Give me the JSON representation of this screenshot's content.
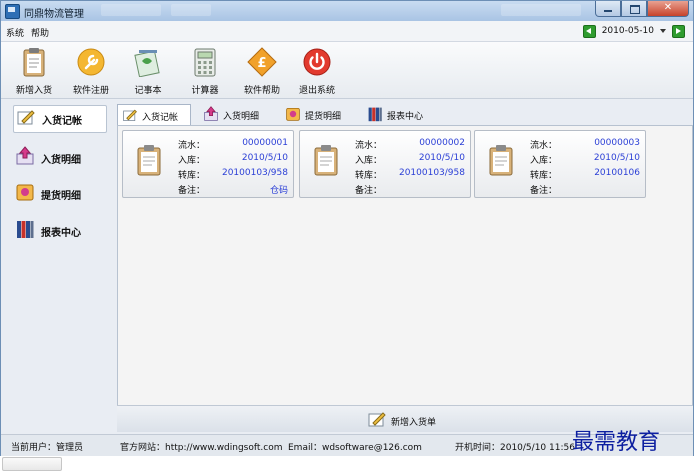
{
  "window": {
    "title": "同鼎物流管理"
  },
  "menu": {
    "items": [
      "系统",
      "帮助"
    ],
    "date": "2010-05-10"
  },
  "toolbar": {
    "buttons": [
      {
        "label": "新增入货",
        "icon": "clipboard-icon"
      },
      {
        "label": "软件注册",
        "icon": "wrench-icon"
      },
      {
        "label": "记事本",
        "icon": "notebook-icon"
      },
      {
        "label": "计算器",
        "icon": "calculator-icon"
      },
      {
        "label": "软件帮助",
        "icon": "help-icon"
      },
      {
        "label": "退出系统",
        "icon": "power-icon"
      }
    ]
  },
  "sidebar": {
    "items": [
      {
        "label": "入货记帐",
        "icon": "pencil-paper-icon"
      },
      {
        "label": "入货明细",
        "icon": "import-arrow-icon"
      },
      {
        "label": "提货明细",
        "icon": "export-icon"
      },
      {
        "label": "报表中心",
        "icon": "binders-icon"
      }
    ]
  },
  "tabs": [
    {
      "label": "入货记帐",
      "icon": "pencil-paper-icon"
    },
    {
      "label": "入货明细",
      "icon": "import-arrow-icon"
    },
    {
      "label": "提货明细",
      "icon": "export-icon"
    },
    {
      "label": "报表中心",
      "icon": "binders-icon"
    }
  ],
  "card_labels": [
    "流水：",
    "入库：",
    "转库：",
    "备注："
  ],
  "cards": [
    {
      "serial": "00000001",
      "in_date": "2010/5/10",
      "transfer": "20100103/958",
      "note": "仓码"
    },
    {
      "serial": "00000002",
      "in_date": "2010/5/10",
      "transfer": "20100103/958",
      "note": ""
    },
    {
      "serial": "00000003",
      "in_date": "2010/5/10",
      "transfer": "20100106",
      "note": ""
    }
  ],
  "new_entry_button": "新增入货单",
  "status": {
    "user": "当前用户：管理员",
    "website": "官方网站：http://www.wdingsoft.com",
    "email": "Email：wdsoftware@126.com",
    "boot_time": "开机时间：2010/5/10 11:56"
  },
  "watermark": "最需教育",
  "colors": {
    "link_blue": "#2b3fd6",
    "titlebar": "#a9c4e4",
    "close_red": "#c7432b",
    "nav_green": "#2f9c2f"
  }
}
